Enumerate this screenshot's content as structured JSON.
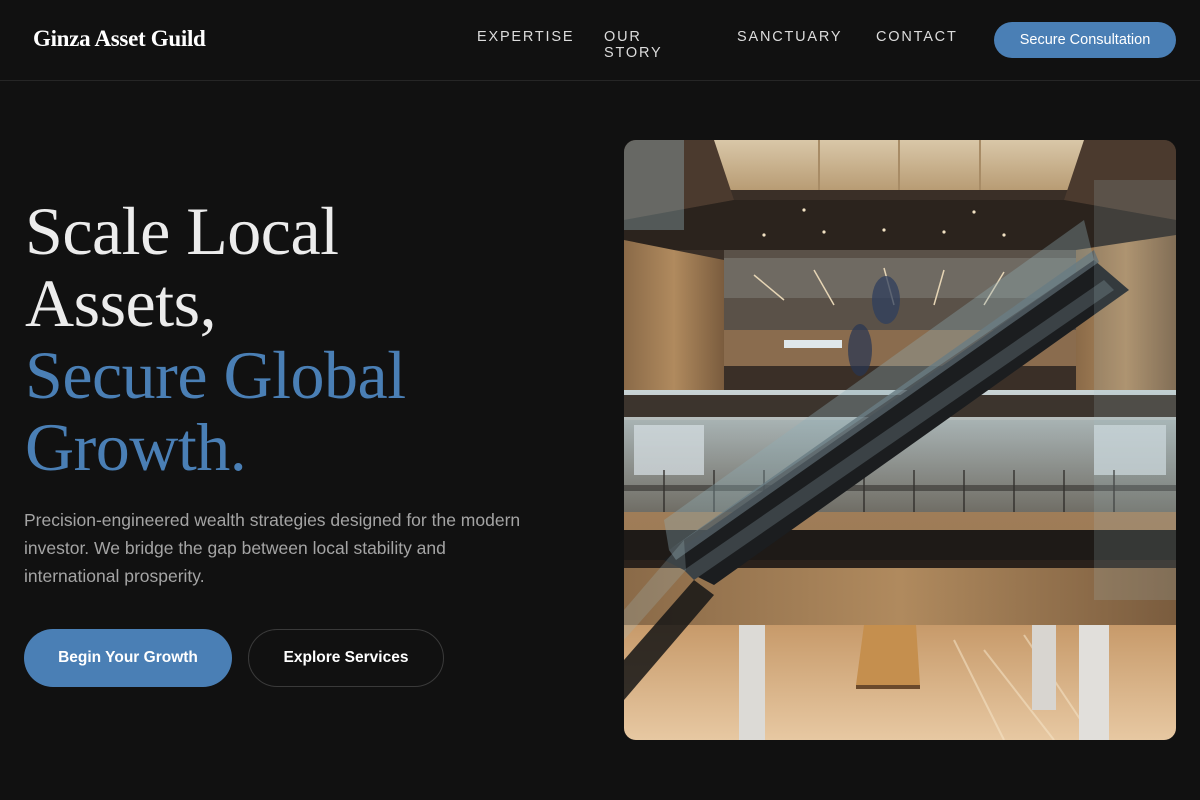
{
  "header": {
    "brand": "Ginza Asset Guild",
    "nav": [
      {
        "label": "EXPERTISE"
      },
      {
        "label": "OUR STORY"
      },
      {
        "label": "SANCTUARY"
      },
      {
        "label": "CONTACT"
      }
    ],
    "cta_label": "Secure Consultation"
  },
  "hero": {
    "headline_line1": "Scale Local",
    "headline_line2": "Assets,",
    "headline_accent_line1": "Secure Global",
    "headline_accent_line2": "Growth.",
    "lede": "Precision-engineered wealth strategies designed for the modern investor. We bridge the gap between local stability and international prosperity.",
    "primary_button": "Begin Your Growth",
    "secondary_button": "Explore Services"
  },
  "colors": {
    "background": "#111111",
    "accent": "#4a7fb5",
    "text": "#ececec",
    "muted": "#a4a4a4"
  }
}
